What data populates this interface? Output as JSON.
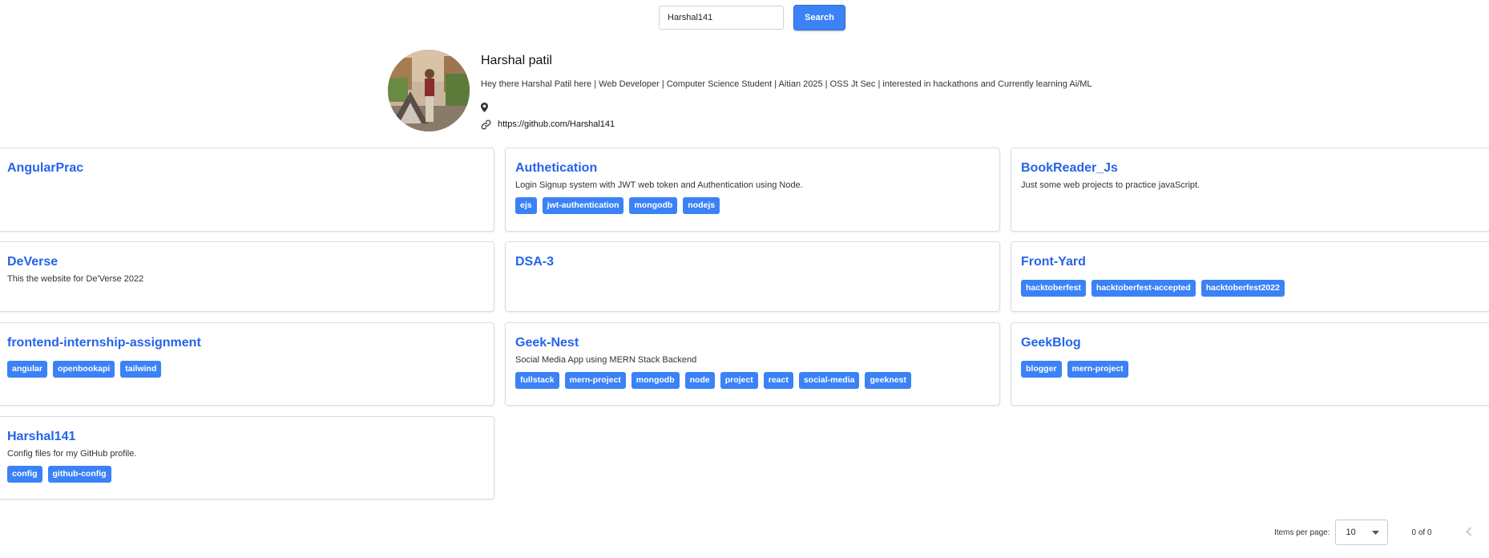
{
  "search": {
    "input_value": "Harshal141",
    "button_label": "Search"
  },
  "profile": {
    "name": "Harshal patil",
    "bio": "Hey there Harshal Patil here | Web Developer | Computer Science Student | Aitian 2025 | OSS Jt Sec | interested in hackathons and Currently learning Ai/ML",
    "location": "",
    "github_url": "https://github.com/Harshal141"
  },
  "repos": [
    {
      "name": "AngularPrac",
      "description": "",
      "topics": []
    },
    {
      "name": "Authetication",
      "description": "Login Signup system with JWT web token and Authentication using Node.",
      "topics": [
        "ejs",
        "jwt-authentication",
        "mongodb",
        "nodejs"
      ]
    },
    {
      "name": "BookReader_Js",
      "description": "Just some web projects to practice javaScript.",
      "topics": []
    },
    {
      "name": "DeVerse",
      "description": "This the website for De'Verse 2022",
      "topics": []
    },
    {
      "name": "DSA-3",
      "description": "",
      "topics": []
    },
    {
      "name": "Front-Yard",
      "description": "",
      "topics": [
        "hacktoberfest",
        "hacktoberfest-accepted",
        "hacktoberfest2022"
      ]
    },
    {
      "name": "frontend-internship-assignment",
      "description": "",
      "topics": [
        "angular",
        "openbookapi",
        "tailwind"
      ]
    },
    {
      "name": "Geek-Nest",
      "description": "Social Media App using MERN Stack Backend",
      "topics": [
        "fullstack",
        "mern-project",
        "mongodb",
        "node",
        "project",
        "react",
        "social-media",
        "geeknest"
      ]
    },
    {
      "name": "GeekBlog",
      "description": "",
      "topics": [
        "blogger",
        "mern-project"
      ]
    },
    {
      "name": "Harshal141",
      "description": "Config files for my GitHub profile.",
      "topics": [
        "config",
        "github-config"
      ]
    }
  ],
  "pagination": {
    "items_per_page_label": "Items per page:",
    "items_per_page_value": "10",
    "range_label": "0 of 0"
  },
  "icons": {
    "location": "map-pin-icon",
    "link": "link-icon",
    "dropdown": "caret-down-icon",
    "prev": "chevron-left-icon"
  },
  "colors": {
    "accent": "#3b82f6",
    "repo_title": "#2563eb"
  }
}
